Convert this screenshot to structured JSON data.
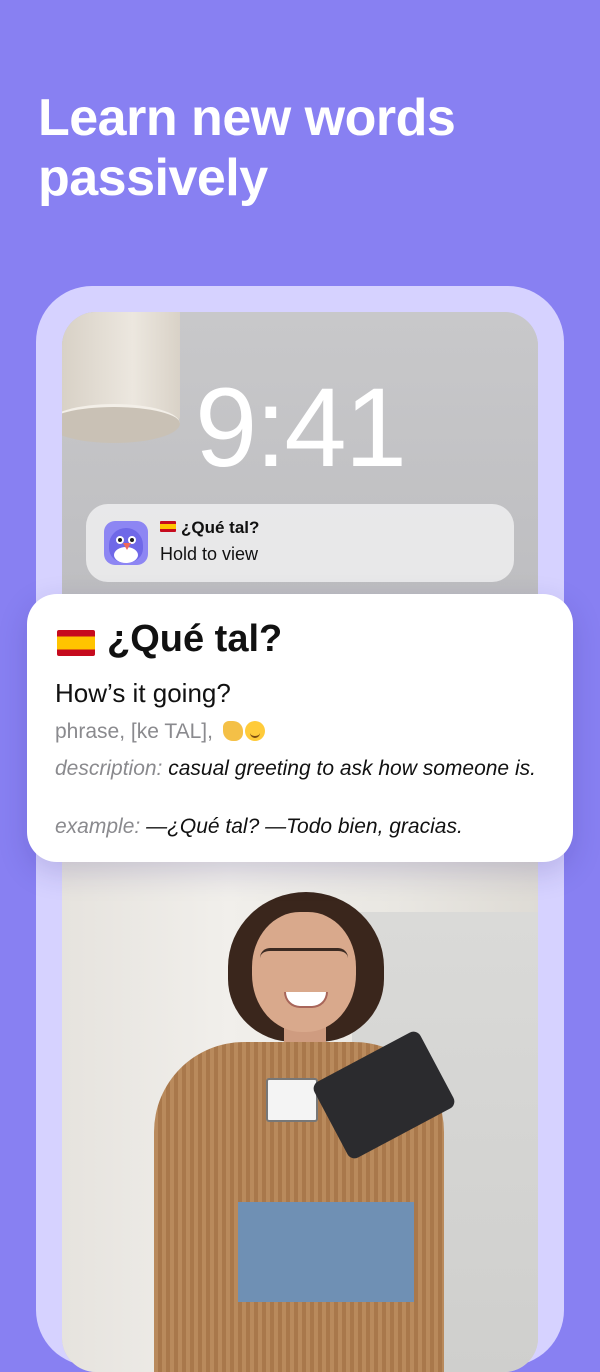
{
  "headline": "Learn new words passively",
  "lock_screen": {
    "time": "9:41"
  },
  "notification": {
    "title": "¿Qué tal?",
    "body": "Hold to view",
    "app_icon": "bird-mascot-icon",
    "flag": "spain-flag-icon"
  },
  "card": {
    "word": "¿Qué tal?",
    "translation": "How’s it going?",
    "meta": "phrase, [ke TAL],",
    "meta_emojis": [
      "waving-hand-emoji",
      "smiling-face-emoji"
    ],
    "description_label": "description:",
    "description_text": "casual greeting to ask how someone is.",
    "example_label": "example:",
    "example_text": "—¿Qué tal? —Todo bien, gracias."
  },
  "colors": {
    "background": "#8880f2",
    "frame": "#d6d2ff",
    "card": "#ffffff",
    "muted_text": "#8a8a8e"
  }
}
